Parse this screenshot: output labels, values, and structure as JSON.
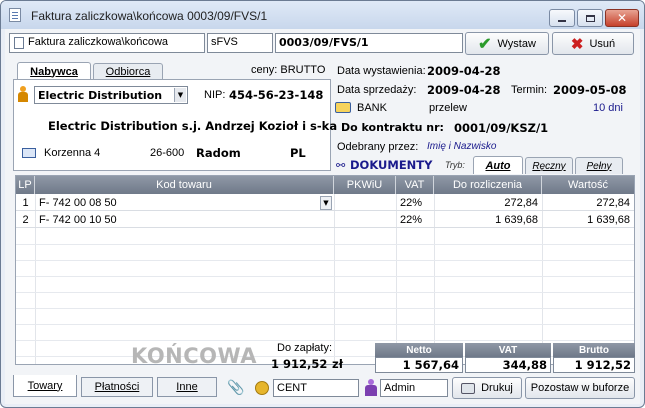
{
  "window": {
    "title": "Faktura zaliczkowa\\końcowa 0003/09/FVS/1"
  },
  "toolbar": {
    "doc_type": "Faktura zaliczkowa\\końcowa",
    "series": "sFVS",
    "number": "0003/09/FVS/1",
    "issue_label": "Wystaw",
    "delete_label": "Usuń"
  },
  "party_tabs": [
    "Nabywca",
    "Odbiorca"
  ],
  "prices": {
    "label": "ceny:",
    "value": "BRUTTO"
  },
  "buyer": {
    "name": "Electric Distribution",
    "nip_label": "NIP:",
    "nip": "454-56-23-148",
    "full_name": "Electric Distribution s.j. Andrzej Kozioł i s-ka",
    "street": "Korzenna 4",
    "postcode": "26-600",
    "city": "Radom",
    "country": "PL"
  },
  "dates": {
    "issue_label": "Data wystawienia:",
    "issue": "2009-04-28",
    "sale_label": "Data sprzedaży:",
    "sale": "2009-04-28",
    "due_label": "Termin:",
    "due": "2009-05-08"
  },
  "payment": {
    "bank": "BANK",
    "method": "przelew",
    "days": "10 dni"
  },
  "contract": {
    "label": "Do kontraktu nr:",
    "value": "0001/09/KSZ/1"
  },
  "received": {
    "label": "Odebrany przez:",
    "placeholder": "Imię i Nazwisko"
  },
  "documents": {
    "label": "DOKUMENTY",
    "mode_label": "Tryb:",
    "tabs": [
      "Auto",
      "Ręczny",
      "Pełny"
    ]
  },
  "table": {
    "headers": [
      "LP",
      "Kod towaru",
      "PKWiU",
      "VAT",
      "Do rozliczenia",
      "Wartość"
    ],
    "rows": [
      {
        "lp": "1",
        "code": "F- 742 00 08 50",
        "pkwiu": "",
        "vat": "22%",
        "settle": "272,84",
        "value": "272,84"
      },
      {
        "lp": "2",
        "code": "F- 742 00 10 50",
        "pkwiu": "",
        "vat": "22%",
        "settle": "1 639,68",
        "value": "1 639,68"
      }
    ]
  },
  "summary": {
    "stamp": "KOŃCOWA",
    "pay_label": "Do zapłaty:",
    "pay_value": "1 912,52",
    "currency": "zł",
    "netto_label": "Netto",
    "netto": "1 567,64",
    "vat_label": "VAT",
    "vat": "344,88",
    "brutto_label": "Brutto",
    "brutto": "1 912,52"
  },
  "bottom_tabs": [
    "Towary",
    "Płatności",
    "Inne"
  ],
  "status": {
    "currency_mode": "CENT",
    "user": "Admin"
  },
  "actions": {
    "print": "Drukuj",
    "buffer": "Pozostaw w buforze"
  },
  "colors": {
    "accent": "#1a1a8c",
    "header": "#6f7989",
    "ok": "#2b9b2b",
    "danger": "#cc1f1f"
  }
}
